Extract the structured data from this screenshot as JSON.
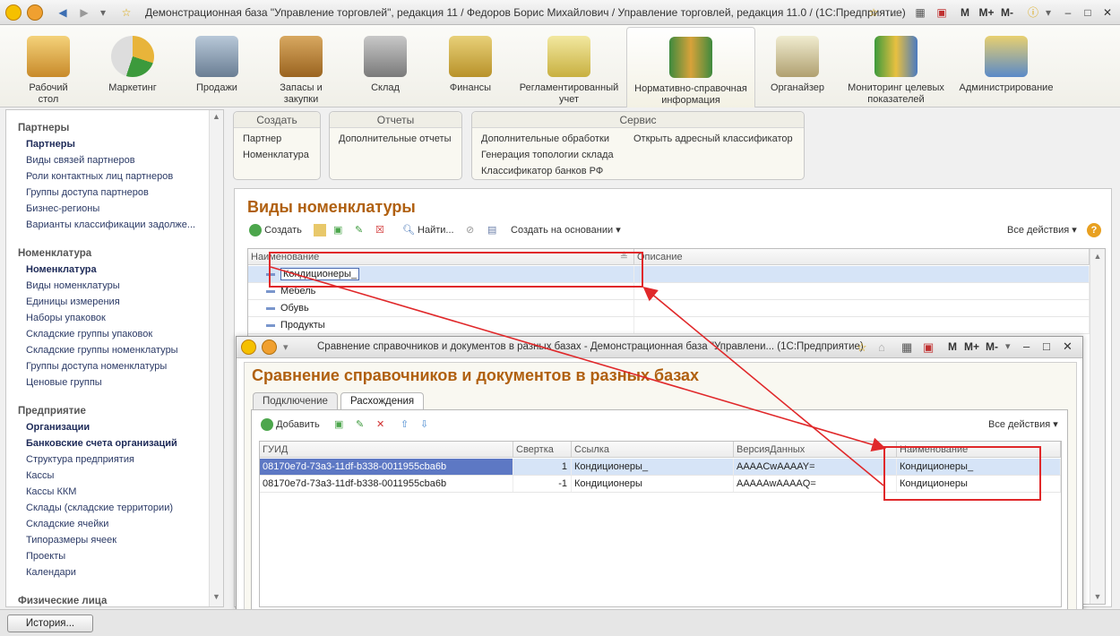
{
  "window": {
    "title": "Демонстрационная база \"Управление торговлей\", редакция 11 / Федоров Борис Михайлович / Управление торговлей, редакция 11.0 /  (1С:Предприятие)",
    "buttons": [
      "M",
      "M+",
      "M-"
    ]
  },
  "sections": [
    {
      "label": "Рабочий стол"
    },
    {
      "label": "Маркетинг"
    },
    {
      "label": "Продажи"
    },
    {
      "label": "Запасы и закупки"
    },
    {
      "label": "Склад"
    },
    {
      "label": "Финансы"
    },
    {
      "label": "Регламентированный учет"
    },
    {
      "label": "Нормативно-справочная информация",
      "active": true
    },
    {
      "label": "Органайзер"
    },
    {
      "label": "Мониторинг целевых показателей"
    },
    {
      "label": "Администрирование"
    }
  ],
  "sidebar": {
    "groups": [
      {
        "title": "Партнеры",
        "items": [
          "Партнеры",
          "Виды связей партнеров",
          "Роли контактных лиц партнеров",
          "Группы доступа партнеров",
          "Бизнес-регионы",
          "Варианты классификации задолже..."
        ]
      },
      {
        "title": "Номенклатура",
        "items": [
          "Номенклатура",
          "Виды номенклатуры",
          "Единицы измерения",
          "Наборы упаковок",
          "Складские группы упаковок",
          "Складские группы номенклатуры",
          "Группы доступа номенклатуры",
          "Ценовые группы"
        ]
      },
      {
        "title": "Предприятие",
        "items": [
          "Организации",
          "Банковские счета организаций",
          "Структура предприятия",
          "Кассы",
          "Кассы ККМ",
          "Склады (складские территории)",
          "Складские ячейки",
          "Типоразмеры ячеек",
          "Проекты",
          "Календари"
        ]
      },
      {
        "title": "Физические лица",
        "items": []
      }
    ]
  },
  "command_panel": {
    "create": {
      "title": "Создать",
      "items": [
        "Партнер",
        "Номенклатура"
      ]
    },
    "reports": {
      "title": "Отчеты",
      "items": [
        "Дополнительные отчеты"
      ]
    },
    "service": {
      "title": "Сервис",
      "items": [
        "Дополнительные обработки",
        "Генерация топологии склада",
        "Классификатор банков РФ",
        "Открыть адресный классификатор"
      ]
    }
  },
  "main_form": {
    "title": "Виды номенклатуры",
    "toolbar": {
      "create": "Создать",
      "find": "Найти...",
      "create_based": "Создать на основании",
      "all_actions": "Все действия"
    },
    "columns": [
      "Наименование",
      "Описание"
    ],
    "rows": [
      "Кондиционеры_",
      "Мебель",
      "Обувь",
      "Продукты"
    ]
  },
  "dialog": {
    "title": "Сравнение справочников и документов в разных базах - Демонстрационная база \"Управлени...  (1С:Предприятие)",
    "heading": "Сравнение справочников и документов в разных базах",
    "tabs": [
      "Подключение",
      "Расхождения"
    ],
    "toolbar": {
      "add": "Добавить",
      "all_actions": "Все действия"
    },
    "columns": [
      "ГУИД",
      "Свертка",
      "Ссылка",
      "ВерсияДанных",
      "Наименование"
    ],
    "rows": [
      {
        "guid": "08170e7d-73a3-11df-b338-0011955cba6b",
        "svertka": "1",
        "ssylka": "Кондиционеры_",
        "version": "AAAACwAAAAY=",
        "name": "Кондиционеры_"
      },
      {
        "guid": "08170e7d-73a3-11df-b338-0011955cba6b",
        "svertka": "-1",
        "ssylka": "Кондиционеры",
        "version": "AAAAAwAAAAQ=",
        "name": "Кондиционеры"
      }
    ]
  },
  "statusbar": {
    "history": "История..."
  },
  "colors": {
    "accent": "#b06010",
    "annotation": "#e0282a",
    "selection": "#5d78c4"
  }
}
